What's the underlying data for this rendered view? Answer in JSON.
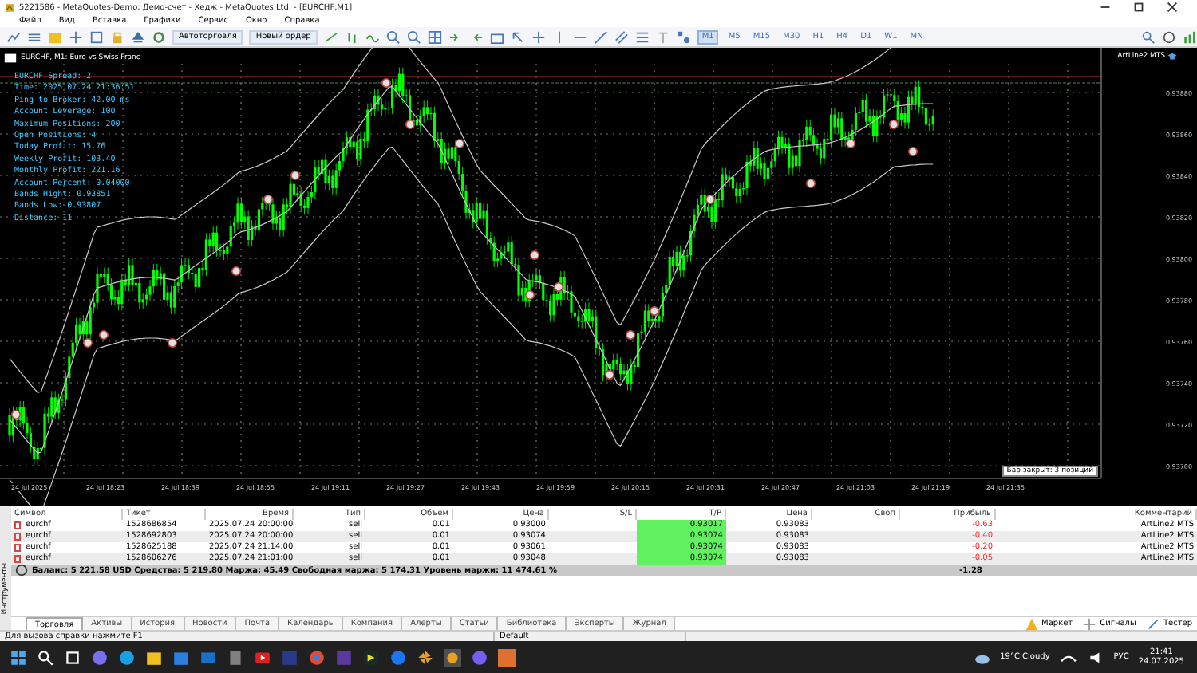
{
  "window": {
    "title": "5221586 - MetaQuotes-Demo: Демо-счет - Хедж - MetaQuotes Ltd. - [EURCHF,M1]"
  },
  "menu": [
    "Файл",
    "Вид",
    "Вставка",
    "Графики",
    "Сервис",
    "Окно",
    "Справка"
  ],
  "toolbar": {
    "buttons": [
      "Автоторговля",
      "Новый ордер"
    ],
    "timeframes": [
      {
        "label": "M1",
        "selected": true
      },
      {
        "label": "M5",
        "selected": false
      },
      {
        "label": "M15",
        "selected": false
      },
      {
        "label": "M30",
        "selected": false
      },
      {
        "label": "H1",
        "selected": false
      },
      {
        "label": "H4",
        "selected": false
      },
      {
        "label": "D1",
        "selected": false
      },
      {
        "label": "W1",
        "selected": false
      },
      {
        "label": "MN",
        "selected": false
      }
    ]
  },
  "chart": {
    "title": "EURCHF, M1:  Euro vs Swiss Franc",
    "expert": "ArtLine2 MTS",
    "status": "Бар закрыт: 3 позиций",
    "info": [
      "EURCHF Spread: 2",
      "Time: 2025.07.24 21:36:51",
      "Ping to Broker: 42.00 ms",
      "Account Leverage: 100",
      "Maximum Positions: 200",
      "Open Positions: 4",
      "Today Profit: 15.76",
      "Weekly Profit: 103.40",
      "Monthly Profit: 221.16",
      "Account Percent:  0.04000",
      "Bands Hight: 0.93851",
      "Bands Low: 0.93807",
      "Distance: 11"
    ],
    "price_labels": [
      "0.93880",
      "0.93860",
      "0.93840",
      "0.93820",
      "0.93800",
      "0.93780",
      "0.93760",
      "0.93740",
      "0.93720",
      "0.93700"
    ],
    "time_labels": [
      "24 Jul 2025",
      "24 Jul 18:23",
      "24 Jul 18:39",
      "24 Jul 18:55",
      "24 Jul 19:11",
      "24 Jul 19:27",
      "24 Jul 19:43",
      "24 Jul 19:59",
      "24 Jul 20:15",
      "24 Jul 20:31",
      "24 Jul 20:47",
      "24 Jul 21:03",
      "24 Jul 21:19",
      "24 Jul 21:35"
    ]
  },
  "table": {
    "columns": [
      "Символ",
      "Тикет",
      "Время",
      "Тип",
      "Объем",
      "Цена",
      "S/L",
      "T/P",
      "Цена",
      "Своп",
      "Прибыль",
      "Комментарий"
    ],
    "rows": [
      {
        "cells": [
          "eurchf",
          "1528686854",
          "2025.07.24 20:00:00",
          "sell",
          "0.01",
          "0.93000",
          "",
          "0.93017",
          "0.93083",
          "",
          "-0.63",
          "ArtLine2 MTS"
        ]
      },
      {
        "cells": [
          "eurchf",
          "1528692803",
          "2025.07.24 20:00:00",
          "sell",
          "0.01",
          "0.93074",
          "",
          "0.93074",
          "0.93083",
          "",
          "-0.40",
          "ArtLine2 MTS"
        ]
      },
      {
        "cells": [
          "eurchf",
          "1528625188",
          "2025.07.24 21:14:00",
          "sell",
          "0.01",
          "0.93061",
          "",
          "0.93074",
          "0.93083",
          "",
          "-0.20",
          "ArtLine2 MTS"
        ]
      },
      {
        "cells": [
          "eurchf",
          "1528606276",
          "2025.07.24 21:01:00",
          "sell",
          "0.01",
          "0.93048",
          "",
          "0.93074",
          "0.93083",
          "",
          "-0.05",
          "ArtLine2 MTS"
        ]
      }
    ],
    "summary": "Баланс: 5 221.58 USD  Средства: 5 219.80  Маржа: 45.49  Свободная маржа: 5 174.31  Уровень маржи: 11 474.61 %",
    "summary_total": "-1.28"
  },
  "side_label": "Инструменты",
  "tabs": [
    {
      "label": "Торговля",
      "selected": true
    },
    {
      "label": "Активы",
      "selected": false
    },
    {
      "label": "История",
      "selected": false
    },
    {
      "label": "Новости",
      "selected": false
    },
    {
      "label": "Почта",
      "selected": false
    },
    {
      "label": "Календарь",
      "selected": false
    },
    {
      "label": "Компания",
      "selected": false
    },
    {
      "label": "Алерты",
      "selected": false
    },
    {
      "label": "Статьи",
      "selected": false
    },
    {
      "label": "Библиотека",
      "selected": false
    },
    {
      "label": "Эксперты",
      "selected": false
    },
    {
      "label": "Журнал",
      "selected": false
    }
  ],
  "right_tabs": [
    "Маркет",
    "Сигналы",
    "Тестер"
  ],
  "status_bar": [
    "Для вызова справки нажмите F1",
    "Default"
  ],
  "taskbar": {
    "weather": "19°C  Cloudy",
    "language": "РУС",
    "time": "21:41",
    "date": "24.07.2025"
  }
}
